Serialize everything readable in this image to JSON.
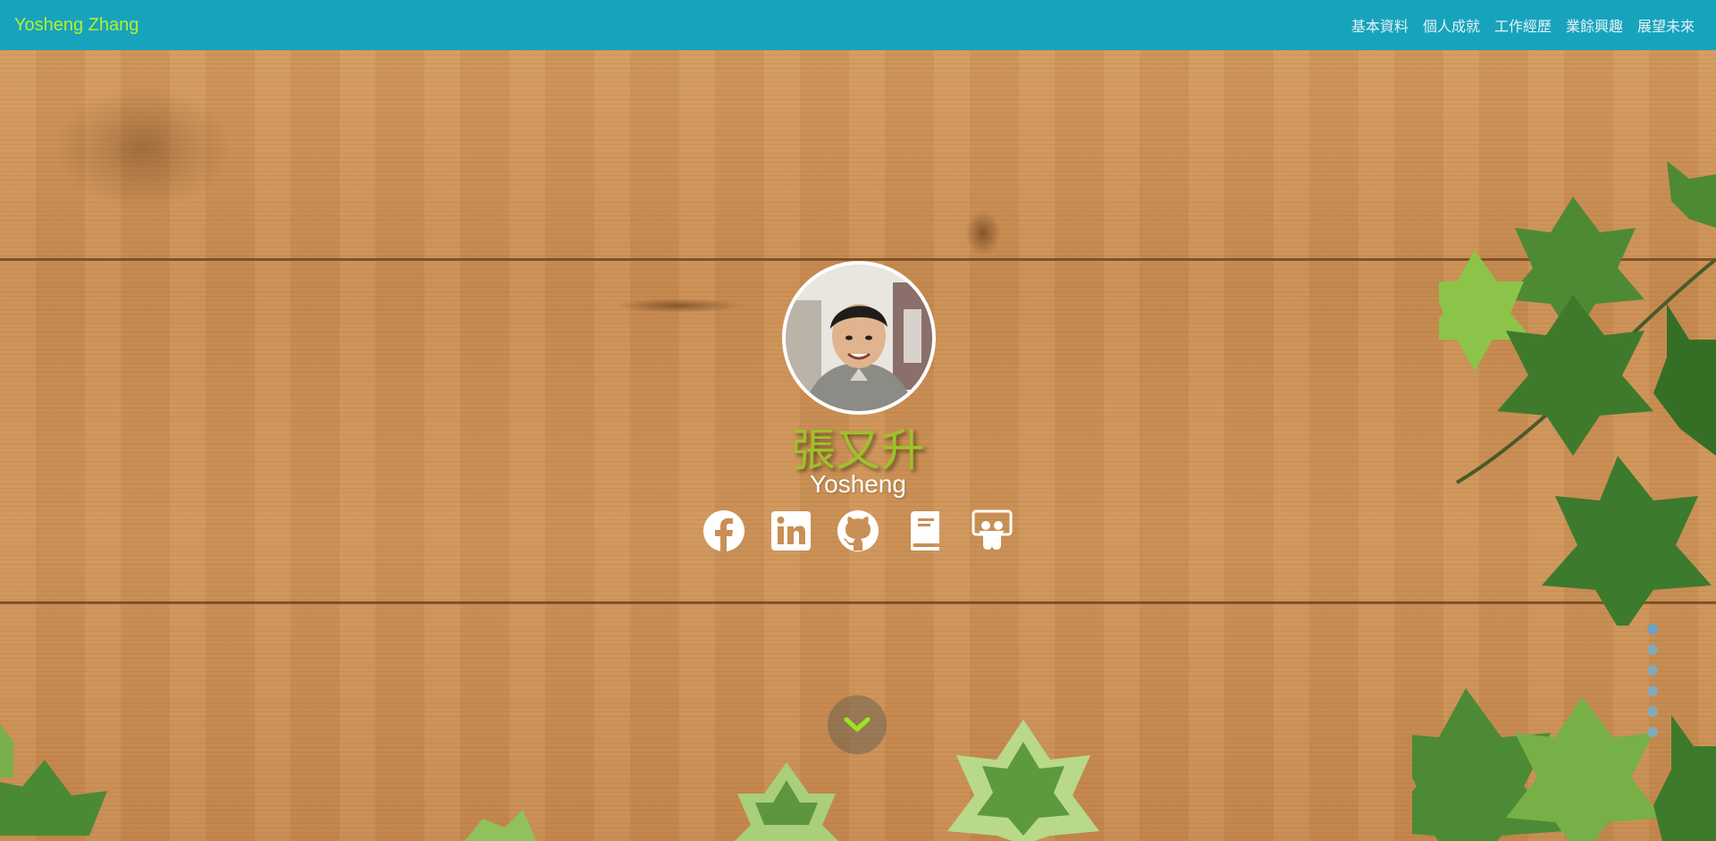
{
  "navbar": {
    "brand": "Yosheng Zhang",
    "links": [
      "基本資料",
      "個人成就",
      "工作經歷",
      "業餘興趣",
      "展望未來"
    ]
  },
  "hero": {
    "name_zh": "張又升",
    "name_en": "Yosheng",
    "avatar_alt": "profile-photo",
    "socials": [
      {
        "icon": "facebook-icon"
      },
      {
        "icon": "linkedin-icon"
      },
      {
        "icon": "github-icon"
      },
      {
        "icon": "book-icon"
      },
      {
        "icon": "slideshare-icon"
      }
    ],
    "scroll_icon": "chevron-down-icon"
  },
  "section_dots": {
    "count": 6,
    "active_index": 0
  },
  "colors": {
    "navbar_bg": "#18a3bd",
    "brand": "#b4f02c",
    "name_zh": "#9dc22a",
    "chevron": "#9be620"
  }
}
